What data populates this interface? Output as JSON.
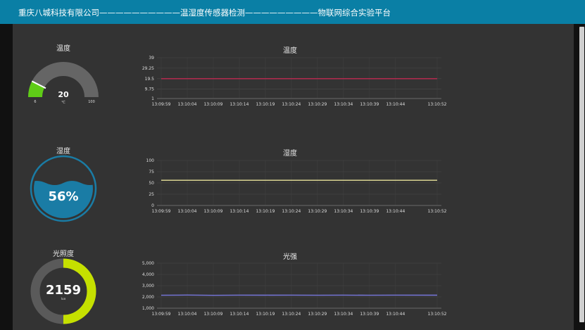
{
  "header": {
    "title": "重庆八城科技有限公司——————————温湿度传感器检测—————————物联网综合实验平台"
  },
  "colors": {
    "header_bg": "#0a7fa5",
    "panel_bg": "#333333",
    "temp_line": "#c02a52",
    "humid_line": "#e8e39a",
    "light_line": "#7777dd",
    "gauge_fill": "#5fcc17",
    "water": "#1a7ca5",
    "donut_fill": "#c5e000"
  },
  "temperature_gauge": {
    "title": "温度",
    "value": "20",
    "unit": "℃",
    "min": "6",
    "max": "100"
  },
  "humidity_gauge": {
    "title": "湿度",
    "value": "56%"
  },
  "light_gauge": {
    "title": "光照度",
    "value": "2159",
    "unit": "lux"
  },
  "time_labels": [
    "13:09:59",
    "13:10:04",
    "13:10:09",
    "13:10:14",
    "13:10:19",
    "13:10:24",
    "13:10:29",
    "13:10:34",
    "13:10:39",
    "13:10:44",
    "13:10:52"
  ],
  "chart_data": [
    {
      "type": "line",
      "title": "温度",
      "x": [
        "13:09:59",
        "13:10:04",
        "13:10:09",
        "13:10:14",
        "13:10:19",
        "13:10:24",
        "13:10:29",
        "13:10:34",
        "13:10:39",
        "13:10:44",
        "13:10:52"
      ],
      "series": [
        {
          "values": [
            19.5,
            19.5,
            19.5,
            19.5,
            19.5,
            19.5,
            19.5,
            19.5,
            19.5,
            19.5,
            19.5
          ]
        }
      ],
      "ytick_labels": [
        "1",
        "9.75",
        "19.5",
        "29.25",
        "39"
      ],
      "ytick_values": [
        1,
        9.75,
        19.5,
        29.25,
        39
      ],
      "ylim": [
        1,
        39
      ],
      "grid": true
    },
    {
      "type": "line",
      "title": "湿度",
      "x": [
        "13:09:59",
        "13:10:04",
        "13:10:09",
        "13:10:14",
        "13:10:19",
        "13:10:24",
        "13:10:29",
        "13:10:34",
        "13:10:39",
        "13:10:44",
        "13:10:52"
      ],
      "series": [
        {
          "values": [
            56,
            56,
            56,
            56,
            56,
            56,
            56,
            56,
            56,
            56,
            56
          ]
        }
      ],
      "ytick_labels": [
        "0",
        "25",
        "50",
        "75",
        "100"
      ],
      "ytick_values": [
        0,
        25,
        50,
        75,
        100
      ],
      "ylim": [
        0,
        100
      ],
      "grid": true
    },
    {
      "type": "line",
      "title": "光强",
      "x": [
        "13:09:59",
        "13:10:04",
        "13:10:09",
        "13:10:14",
        "13:10:19",
        "13:10:24",
        "13:10:29",
        "13:10:34",
        "13:10:39",
        "13:10:44",
        "13:10:52"
      ],
      "series": [
        {
          "values": [
            2150,
            2170,
            2145,
            2160,
            2155,
            2165,
            2150,
            2160,
            2150,
            2165,
            2155
          ]
        }
      ],
      "ytick_labels": [
        "1,000",
        "2,000",
        "3,000",
        "4,000",
        "5,000"
      ],
      "ytick_values": [
        1000,
        2000,
        3000,
        4000,
        5000
      ],
      "ylim": [
        1000,
        5000
      ],
      "grid": true
    }
  ]
}
